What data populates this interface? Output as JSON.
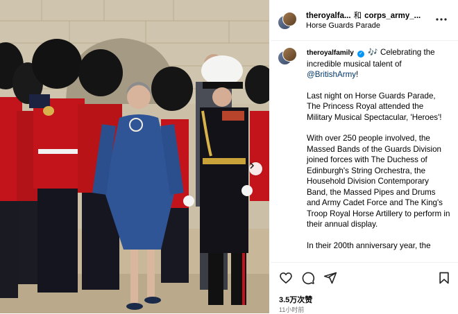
{
  "header": {
    "user_primary": "theroyalfa...",
    "conjunction": "和",
    "user_secondary": "corps_army_...",
    "location": "Horse Guards Parade"
  },
  "caption": {
    "username": "theroyalfamily",
    "line1": "Celebrating the incredible musical talent of",
    "mention": "@BritishArmy",
    "mention_suffix": "!",
    "paragraphs": [
      "Last night on Horse Guards Parade, The Princess Royal attended the Military Musical Spectacular, 'Heroes'!",
      "With over 250 people involved, the Massed Bands of the Guards Division joined forces with The Duchess of Edinburgh's String Orchestra, the Household Division Contemporary Band, the Massed Pipes and Drums and Army Cadet Force and The King's Troop Royal Horse Artillery to perform in their annual display.",
      "In their 200th anniversary year, the"
    ]
  },
  "stats": {
    "views": "3.5万次赞",
    "time_ago": "11小时前"
  },
  "icons": {
    "like": "heart-icon",
    "comment": "comment-icon",
    "share": "send-icon",
    "save": "bookmark-icon",
    "music": "music-notes-icon",
    "next": "chevron-right-icon",
    "more": "more-dots-icon"
  },
  "colors": {
    "verified": "#0095f6",
    "mention": "#00376b",
    "guard_tunic": "#c4141b",
    "dress": "#2f5597"
  }
}
